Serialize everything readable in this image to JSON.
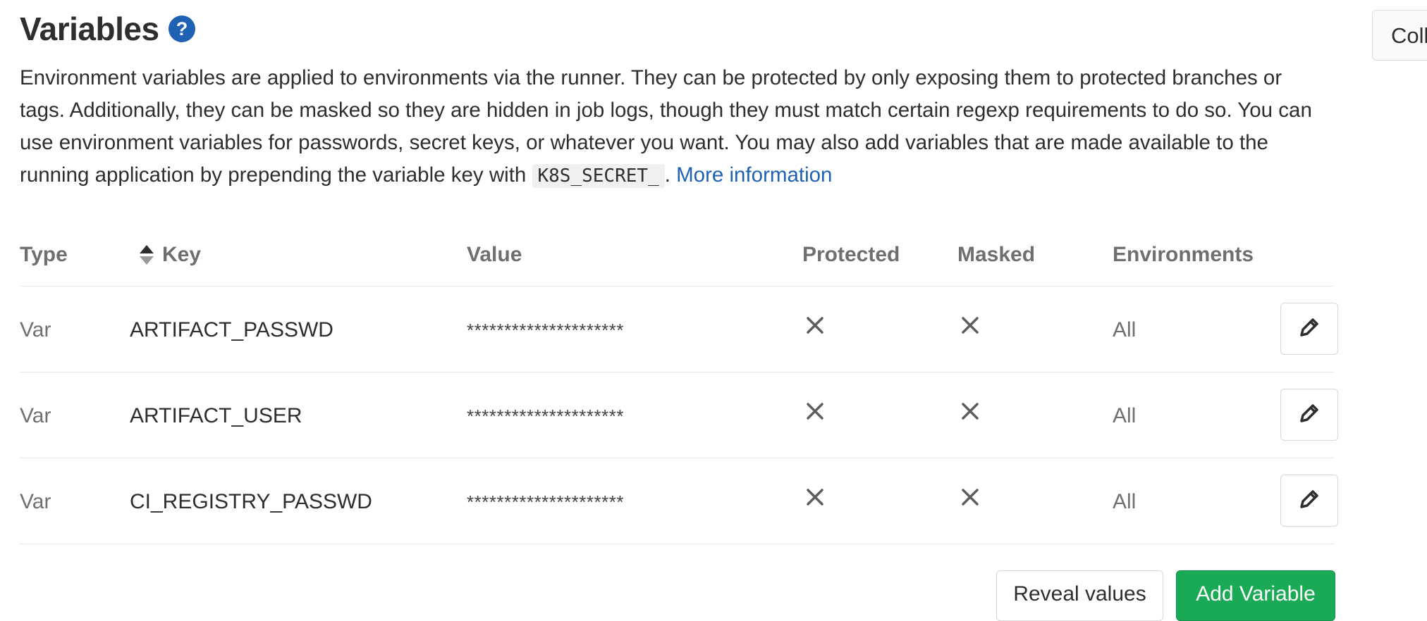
{
  "header": {
    "title": "Variables",
    "help_icon": "question-circle-icon",
    "collapse_label": "Collapse"
  },
  "description": {
    "text_before_code": "Environment variables are applied to environments via the runner. They can be protected by only exposing them to protected branches or tags. Additionally, they can be masked so they are hidden in job logs, though they must match certain regexp requirements to do so. You can use environment variables for passwords, secret keys, or whatever you want. You may also add variables that are made available to the running application by prepending the variable key with ",
    "code": "K8S_SECRET_",
    "text_after_code": ". ",
    "link": "More information"
  },
  "table": {
    "columns": {
      "type": "Type",
      "key": "Key",
      "value": "Value",
      "protected": "Protected",
      "masked": "Masked",
      "environments": "Environments"
    },
    "rows": [
      {
        "type": "Var",
        "key": "ARTIFACT_PASSWD",
        "value": "*********************",
        "protected": false,
        "masked": false,
        "environments": "All"
      },
      {
        "type": "Var",
        "key": "ARTIFACT_USER",
        "value": "*********************",
        "protected": false,
        "masked": false,
        "environments": "All"
      },
      {
        "type": "Var",
        "key": "CI_REGISTRY_PASSWD",
        "value": "*********************",
        "protected": false,
        "masked": false,
        "environments": "All"
      }
    ]
  },
  "buttons": {
    "reveal": "Reveal values",
    "add": "Add Variable"
  },
  "colors": {
    "link": "#1f62b4",
    "primary_green": "#1aaa55",
    "help_blue": "#1f62b4"
  }
}
